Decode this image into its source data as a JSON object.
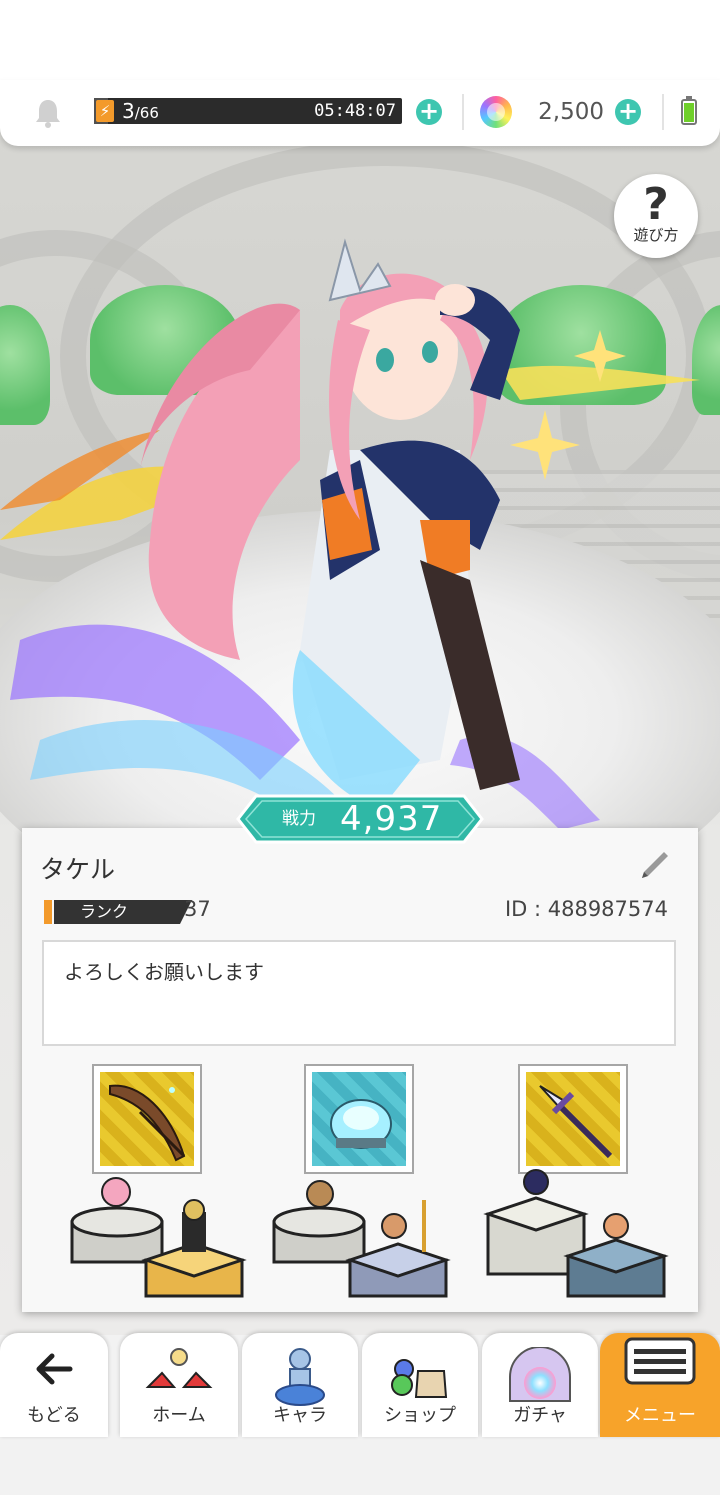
{
  "topbar": {
    "stamina_current": "3",
    "stamina_max": "/66",
    "stamina_fill": 0.045,
    "stamina_timer": "05:48:07",
    "gem_count": "2,500",
    "accent_color": "#3ec6b0"
  },
  "help": {
    "label": "遊び方"
  },
  "power": {
    "label": "戦力",
    "value": "4,937"
  },
  "profile": {
    "name": "タケル",
    "rank_label": "ランク",
    "rank_value": "37",
    "id_text": "ID : 488987574",
    "message": "よろしくお願いします"
  },
  "teams": [
    {
      "item_icon": "feather-quill-icon"
    },
    {
      "item_icon": "crystal-orb-icon"
    },
    {
      "item_icon": "spear-icon"
    }
  ],
  "nav": {
    "back": "もどる",
    "home": "ホーム",
    "chara": "キャラ",
    "shop": "ショップ",
    "gacha": "ガチャ",
    "menu": "メニュー",
    "active_color": "#f7a32a"
  }
}
